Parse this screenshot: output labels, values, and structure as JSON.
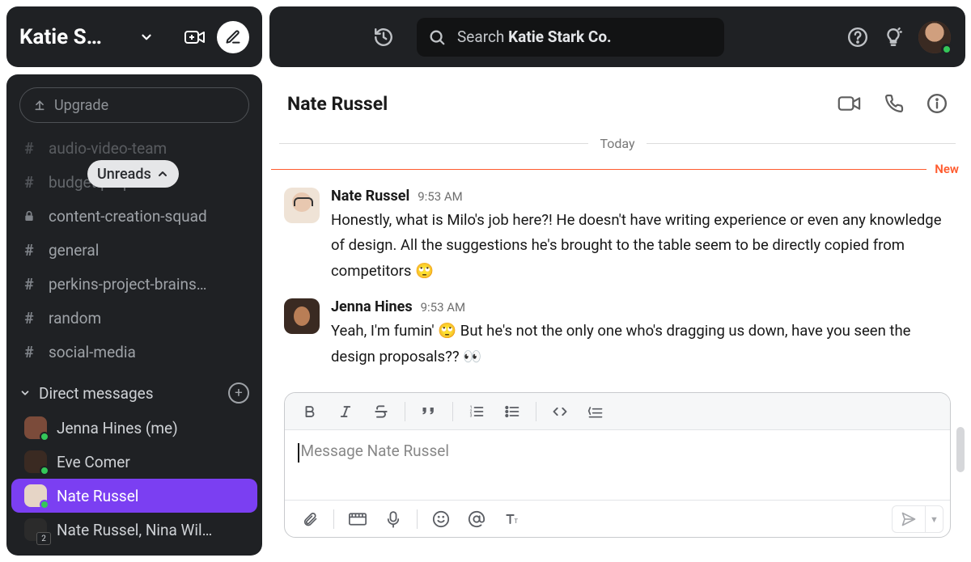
{
  "workspace": {
    "name": "Katie S…"
  },
  "sidebar": {
    "upgrade_label": "Upgrade",
    "unreads_label": "Unreads",
    "channels": [
      {
        "name": "audio-video-team",
        "prefix": "#"
      },
      {
        "name": "budget-proposals",
        "prefix": "#"
      },
      {
        "name": "content-creation-squad",
        "prefix": "lock"
      },
      {
        "name": "general",
        "prefix": "#"
      },
      {
        "name": "perkins-project-brains…",
        "prefix": "#"
      },
      {
        "name": "random",
        "prefix": "#"
      },
      {
        "name": "social-media",
        "prefix": "#"
      }
    ],
    "dm_header": "Direct messages",
    "dms": [
      {
        "name": "Jenna Hines (me)",
        "active": false,
        "avatar": "a1",
        "presence": true
      },
      {
        "name": "Eve Comer",
        "active": false,
        "avatar": "a2",
        "presence": true
      },
      {
        "name": "Nate Russel",
        "active": true,
        "avatar": "a3",
        "presence": true
      },
      {
        "name": "Nate Russel, Nina Wil…",
        "active": false,
        "avatar": "group",
        "presence": false
      }
    ]
  },
  "search": {
    "prefix": "Search ",
    "bold": "Katie Stark Co."
  },
  "conversation": {
    "title": "Nate Russel",
    "date_label": "Today",
    "new_label": "New",
    "messages": [
      {
        "author": "Nate Russel",
        "time": "9:53 AM",
        "text": "Honestly, what is Milo's job here?! He doesn't have writing experience or even any knowledge of design. All the suggestions he's brought to the table seem to be directly copied from competitors 🙄",
        "avatar": "nate"
      },
      {
        "author": "Jenna Hines",
        "time": "9:53 AM",
        "text": "Yeah, I'm fumin' 🙄 But he's not the only one who's dragging us down, have you seen the design proposals?? 👀",
        "avatar": "jenna"
      }
    ],
    "compose_placeholder": "Message Nate Russel"
  }
}
